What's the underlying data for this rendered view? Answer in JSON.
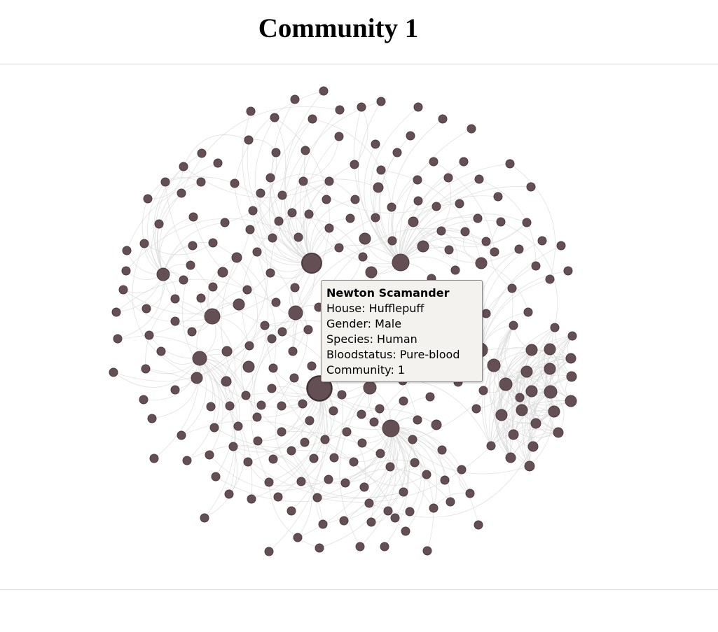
{
  "page": {
    "title": "Community 1"
  },
  "tooltip": {
    "name": "Newton Scamander",
    "house": "House: Hufflepuff",
    "gender": "Gender: Male",
    "species": "Species: Human",
    "bloodstatus": "Bloodstatus: Pure-blood",
    "community": "Community: 1"
  },
  "colors": {
    "node": "#644f54",
    "node_stroke": "#4d3c40",
    "edge": "#d6d6d6",
    "hover_node": "#5a4448"
  }
}
